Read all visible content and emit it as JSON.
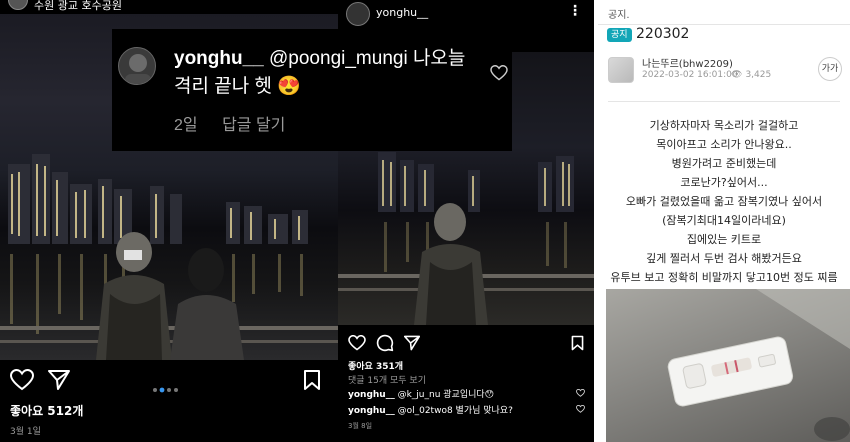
{
  "left_post": {
    "location": "수원 광교 호수공원",
    "likes": "좋아요 512개",
    "date": "3월 1일"
  },
  "overlay_comment": {
    "user": "yonghu__",
    "text": "@poongi_mungi 나오늘 격리 끝나 헷",
    "emoji": "😍",
    "time": "2일",
    "reply": "답글 달기"
  },
  "middle_post": {
    "user": "yonghu__",
    "likes": "좋아요 351개",
    "view_comments": "댓글 15개 모두 보기",
    "comments": [
      {
        "user": "yonghu__",
        "text": "@k_ju_nu 광교입니다😯"
      },
      {
        "user": "yonghu__",
        "text": "@ol_02two8 별가님 맞나요?"
      }
    ],
    "date": "3월 8일"
  },
  "community_post": {
    "breadcrumb": "공지.",
    "badge": "공지",
    "title": "220302",
    "author": "나는뚜르(bhw2209)",
    "date": "2022-03-02 16:01:00",
    "views": "3,425",
    "go_button": "가가",
    "body_lines": [
      "기상하자마자 목소리가 걸걸하고",
      "목이아프고 소리가 안나왕요..",
      "병원가려고 준비했는데",
      "코로난가?싶어서...",
      "오빠가 걸렸었을때 옮고 잠복기였나 싶어서",
      "(잠복기최대14일이라네요)",
      "집에있는 키트로",
      "깊게 찔러서 두번 검사 해봤거든요",
      "유투브 보고 정확히 비말까지 닿고10번 정도 찌름"
    ]
  },
  "colors": {
    "notice_badge": "#12a6b7",
    "like_heart": "#ffffff",
    "carousel_active_dot": "#3897f0"
  }
}
